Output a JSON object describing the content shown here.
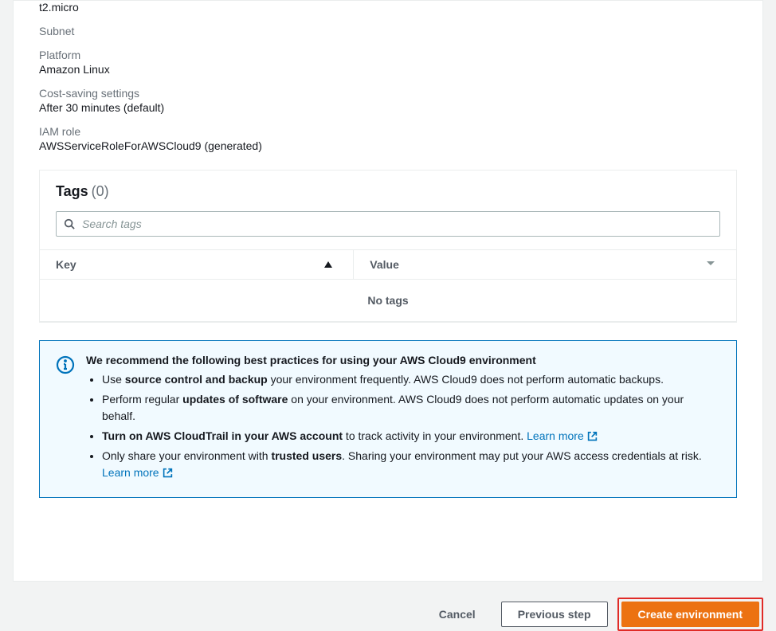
{
  "fields": {
    "instance_type_value": "t2.micro",
    "subnet_label": "Subnet",
    "subnet_value": "",
    "platform_label": "Platform",
    "platform_value": "Amazon Linux",
    "cost_label": "Cost-saving settings",
    "cost_value": "After 30 minutes (default)",
    "iam_label": "IAM role",
    "iam_value": "AWSServiceRoleForAWSCloud9 (generated)"
  },
  "tags": {
    "title": "Tags",
    "count": "(0)",
    "search_placeholder": "Search tags",
    "col_key": "Key",
    "col_value": "Value",
    "empty": "No tags"
  },
  "info": {
    "title": "We recommend the following best practices for using your AWS Cloud9 environment",
    "items": [
      {
        "pre": "Use ",
        "bold": "source control and backup",
        "post": " your environment frequently. AWS Cloud9 does not perform automatic backups.",
        "link": null
      },
      {
        "pre": "Perform regular ",
        "bold": "updates of software",
        "post": " on your environment. AWS Cloud9 does not perform automatic updates on your behalf.",
        "link": null
      },
      {
        "pre": "",
        "bold": "Turn on AWS CloudTrail in your AWS account",
        "post": " to track activity in your environment. ",
        "link": "Learn more"
      },
      {
        "pre": "Only share your environment with ",
        "bold": "trusted users",
        "post": ". Sharing your environment may put your AWS access credentials at risk. ",
        "link": "Learn more"
      }
    ]
  },
  "footer": {
    "cancel": "Cancel",
    "previous": "Previous step",
    "create": "Create environment"
  }
}
